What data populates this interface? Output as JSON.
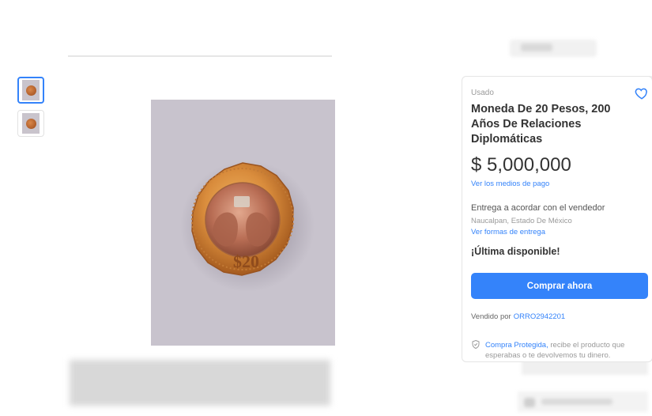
{
  "gallery": {
    "thumbnails": [
      {
        "alt": "coin-thumbnail-1",
        "selected": true
      },
      {
        "alt": "coin-thumbnail-2",
        "selected": false
      }
    ]
  },
  "product": {
    "condition": "Usado",
    "title": "Moneda De 20 Pesos, 200 Años De Relaciones Diplomáticas",
    "price": "$ 5,000,000",
    "payment_link": "Ver los medios de pago",
    "delivery_text": "Entrega a acordar con el vendedor",
    "location": "Naucalpan, Estado De México",
    "shipping_link": "Ver formas de entrega",
    "stock_text": "¡Última disponible!",
    "buy_button": "Comprar ahora",
    "seller_label": "Vendido por",
    "seller_name": "ORRO2942201",
    "protection_link": "Compra Protegida,",
    "protection_text": "recibe el producto que esperabas o te devolvemos tu dinero."
  },
  "colors": {
    "accent": "#3483fa",
    "background": "#ffffff",
    "photo_background": "#c8c3cd"
  },
  "icons": {
    "favorite": "heart-icon",
    "protection": "shield-icon"
  }
}
